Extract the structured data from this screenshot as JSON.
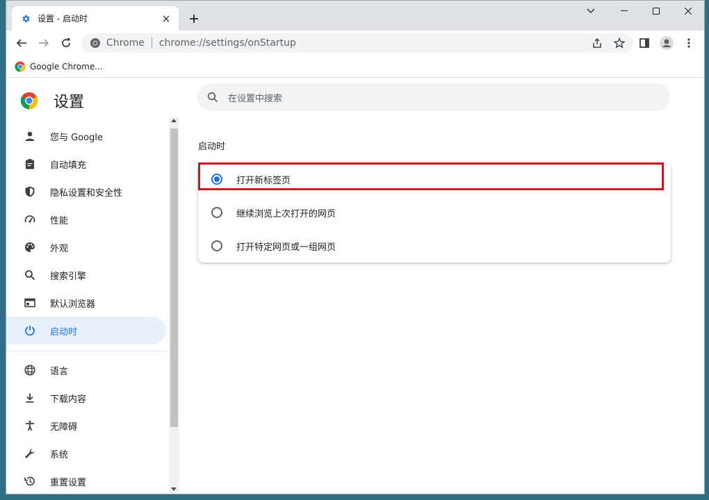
{
  "tab": {
    "title": "设置 - 启动时"
  },
  "omnibox": {
    "site": "Chrome",
    "url": "chrome://settings/onStartup"
  },
  "bookmarks": [
    {
      "label": "Google Chrome..."
    }
  ],
  "settings": {
    "title": "设置",
    "search_placeholder": "在设置中搜索",
    "nav": [
      {
        "label": "您与 Google",
        "icon": "person-icon"
      },
      {
        "label": "自动填充",
        "icon": "clipboard-icon"
      },
      {
        "label": "隐私设置和安全性",
        "icon": "shield-icon"
      },
      {
        "label": "性能",
        "icon": "speedometer-icon"
      },
      {
        "label": "外观",
        "icon": "palette-icon"
      },
      {
        "label": "搜索引擎",
        "icon": "search-icon"
      },
      {
        "label": "默认浏览器",
        "icon": "browser-window-icon"
      },
      {
        "label": "启动时",
        "icon": "power-icon",
        "active": true
      },
      {
        "label": "语言",
        "icon": "globe-icon"
      },
      {
        "label": "下载内容",
        "icon": "download-icon"
      },
      {
        "label": "无障碍",
        "icon": "accessibility-icon"
      },
      {
        "label": "系统",
        "icon": "wrench-icon"
      },
      {
        "label": "重置设置",
        "icon": "reset-history-icon"
      }
    ],
    "section_title": "启动时",
    "options": [
      {
        "label": "打开新标签页",
        "checked": true
      },
      {
        "label": "继续浏览上次打开的网页",
        "checked": false
      },
      {
        "label": "打开特定网页或一组网页",
        "checked": false
      }
    ]
  },
  "colors": {
    "accent": "#1a73e8",
    "highlight_border": "#d3111c",
    "active_nav_bg": "#e8f0fe"
  }
}
